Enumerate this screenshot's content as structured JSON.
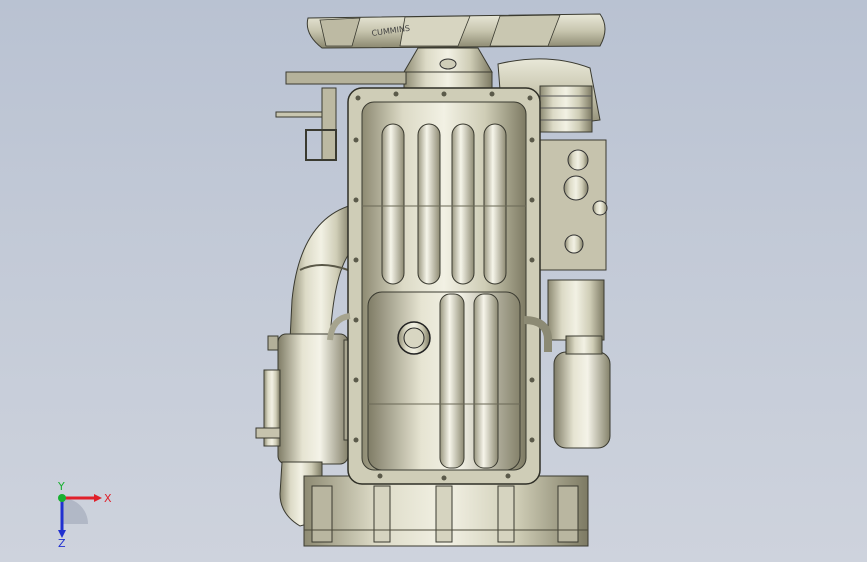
{
  "viewport": {
    "background_top": "#b9c2d2",
    "background_bottom": "#ced3dd",
    "model": "engine-oil-pan-bottom-view"
  },
  "triad": {
    "x_label": "X",
    "y_label": "Y",
    "z_label": "Z",
    "x_color": "#e0202a",
    "y_color": "#18b030",
    "z_color": "#2030d0"
  },
  "fan_label": "CUMMINS"
}
